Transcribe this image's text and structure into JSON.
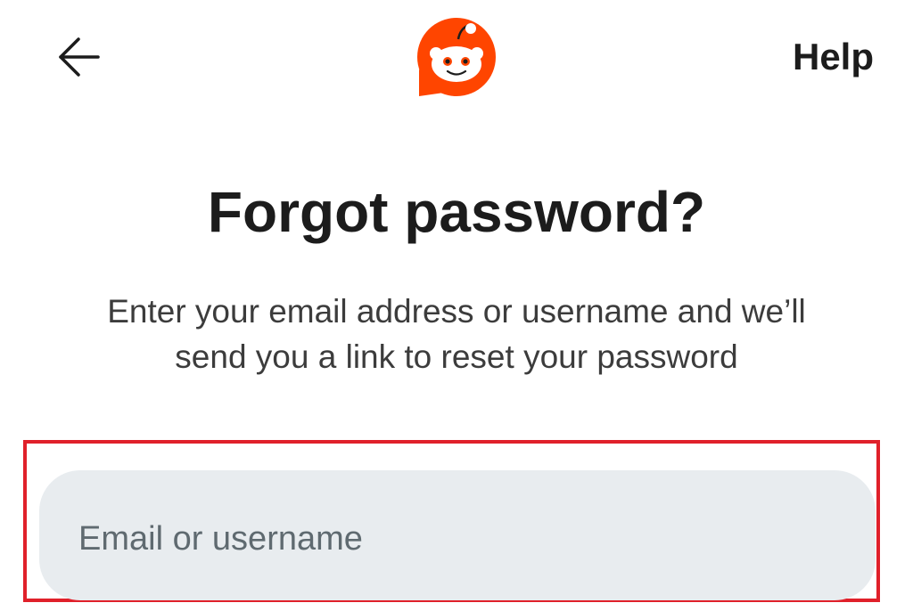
{
  "header": {
    "help_label": "Help"
  },
  "content": {
    "title": "Forgot password?",
    "subtitle_line1": "Enter your email address or username and we’ll",
    "subtitle_line2": "send you a link to reset your password"
  },
  "form": {
    "identifier_placeholder": "Email or username",
    "identifier_value": ""
  },
  "icons": {
    "back": "arrow-left-icon",
    "logo": "reddit-snoo-logo"
  },
  "colors": {
    "brand": "#ff4500",
    "highlight": "#e0202a",
    "input_bg": "#e8ecef",
    "text": "#1c1c1c"
  }
}
